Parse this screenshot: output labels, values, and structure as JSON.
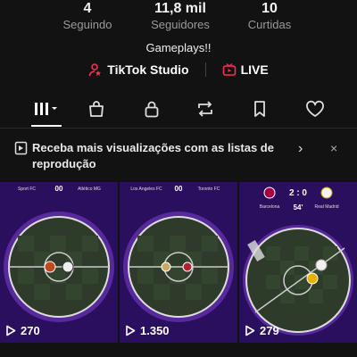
{
  "profile": {
    "stats": [
      {
        "value": "4",
        "label": "Seguindo"
      },
      {
        "value": "11,8 mil",
        "label": "Seguidores"
      },
      {
        "value": "10",
        "label": "Curtidas"
      }
    ],
    "bio": "Gameplays!!"
  },
  "links": {
    "studio": "TikTok Studio",
    "live": "LIVE",
    "accent": "#fe2c55"
  },
  "tabs": [
    "grid-icon",
    "shop-icon",
    "lock-icon",
    "repost-icon",
    "bookmark-icon",
    "heart-icon"
  ],
  "banner": {
    "text": "Receba mais visualizações com as listas de reprodução",
    "chevron": "›",
    "close": "×"
  },
  "videos": [
    {
      "team_left": "Sport FC",
      "time": "00",
      "team_right": "Atlético MG",
      "views": "270"
    },
    {
      "team_left": "Los Angeles FC",
      "time": "00",
      "team_right": "Toronto FC",
      "views": "1.350"
    },
    {
      "team_left": "Barcelona",
      "score": "2 : 0",
      "time": "54'",
      "team_right": "Real Madrid",
      "views": "279"
    }
  ]
}
